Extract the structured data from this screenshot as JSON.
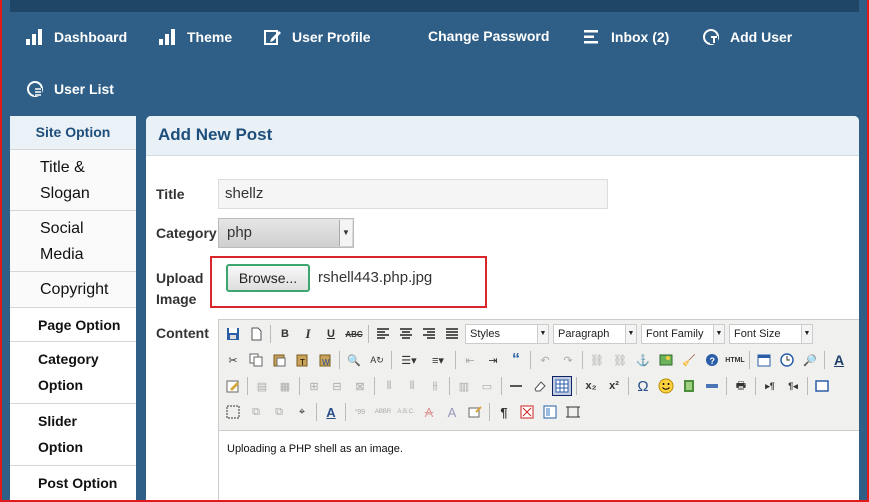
{
  "nav": {
    "items": [
      {
        "label": "Dashboard",
        "icon": "bar-chart-icon"
      },
      {
        "label": "Theme",
        "icon": "bar-chart-icon"
      },
      {
        "label": "User Profile",
        "icon": "edit-icon"
      },
      {
        "label": "Change Password",
        "icon": ""
      },
      {
        "label": "Inbox (2)",
        "icon": "list-icon"
      },
      {
        "label": "Add User",
        "icon": "user-add-icon"
      },
      {
        "label": "User List",
        "icon": "user-list-icon"
      }
    ]
  },
  "sidebar": {
    "site_option": "Site Option",
    "title_slogan": "Title & Slogan",
    "social_media": "Social Media",
    "copyright": "Copyright",
    "page_option": "Page Option",
    "category_option": "Category Option",
    "slider_option": "Slider Option",
    "post_option": "Post Option"
  },
  "panel": {
    "title": "Add New Post",
    "title_label": "Title",
    "title_value": "shellz",
    "category_label": "Category",
    "category_value": "php",
    "upload_label": "Upload Image",
    "browse_label": "Browse...",
    "file_name": "rshell443.php.jpg",
    "content_label": "Content"
  },
  "editor": {
    "styles": "Styles",
    "format": "Paragraph",
    "font_family": "Font Family",
    "font_size": "Font Size",
    "content_text": "Uploading a PHP shell as an image."
  },
  "colors": {
    "nav_bg": "#2f5f87",
    "highlight_red": "#d9262a",
    "browse_green": "#3ca66f"
  }
}
